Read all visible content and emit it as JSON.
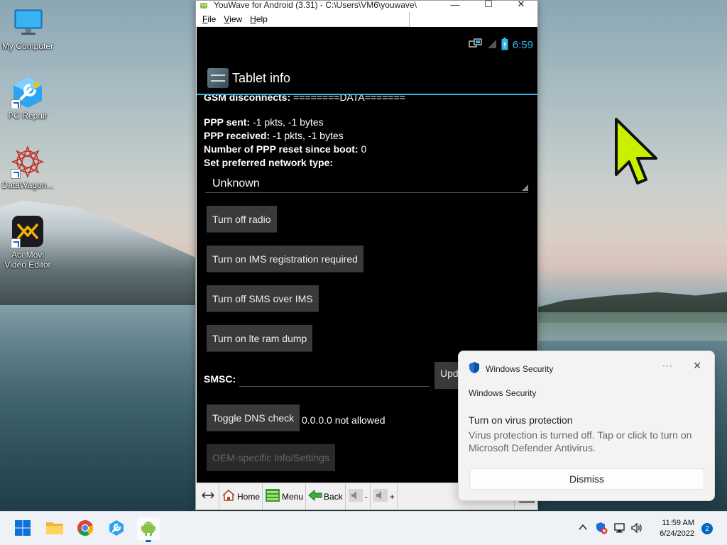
{
  "desktop": {
    "icons": [
      {
        "label": "My Computer",
        "icon": "monitor-icon"
      },
      {
        "label": "PC Repair",
        "icon": "wrench-icon"
      },
      {
        "label": "DataWagon...",
        "icon": "mandala-icon"
      },
      {
        "label_line1": "AceMovi",
        "label_line2": "Video Editor",
        "icon": "acemovi-icon"
      }
    ]
  },
  "youwave": {
    "title": "YouWave for Android (3.31) - C:\\Users\\VM6\\youwave\\",
    "menu": [
      "File",
      "View",
      "Help"
    ],
    "window_controls": {
      "minimize": "—",
      "maximize": "☐",
      "close": "✕"
    },
    "status_bar": {
      "time": "6:59"
    },
    "action_bar": {
      "title": "Tablet info"
    },
    "content": {
      "gsm_disconnects_label": "GSM disconnects:",
      "gsm_disconnects_value": "========DATA=======",
      "ppp_sent_label": "PPP sent:",
      "ppp_sent_value": "-1 pkts, -1 bytes",
      "ppp_received_label": "PPP received:",
      "ppp_received_value": "-1 pkts, -1 bytes",
      "ppp_reset_label": "Number of PPP reset since boot:",
      "ppp_reset_value": "0",
      "network_type_label": "Set preferred network type:",
      "network_type_value": "Unknown",
      "buttons": {
        "radio": "Turn off radio",
        "ims_registration": "Turn on IMS registration required",
        "sms_over_ims": "Turn off SMS over IMS",
        "lte_ram_dump": "Turn on lte ram dump",
        "update": "Upd",
        "dns_check": "Toggle DNS check",
        "oem": "OEM-specific Info/Settings"
      },
      "smsc_label": "SMSC:",
      "dns_value": "0.0.0.0 not allowed"
    },
    "toolbar": {
      "home": "Home",
      "menu": "Menu",
      "back": "Back",
      "vol_down": "-",
      "vol_up": "+"
    }
  },
  "notification": {
    "app": "Windows Security",
    "more": "···",
    "close": "✕",
    "source": "Windows Security",
    "title": "Turn on virus protection",
    "body": "Virus protection is turned off. Tap or click to turn on Microsoft Defender Antivirus.",
    "dismiss": "Dismiss"
  },
  "taskbar": {
    "apps": [
      "start-icon",
      "file-explorer-icon",
      "chrome-icon",
      "pc-repair-icon",
      "youwave-icon"
    ],
    "time": "11:59 AM",
    "date": "6/24/2022",
    "notifications_count": "2"
  },
  "colors": {
    "android_accent": "#33b5e5",
    "cursor": "#c8f000",
    "windows_accent": "#0067c0"
  }
}
